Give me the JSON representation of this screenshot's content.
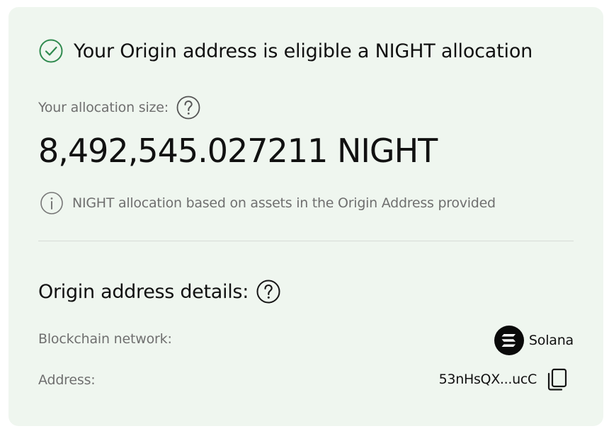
{
  "eligibility": {
    "icon": "check-circle-icon",
    "status_color": "#2f8a4e",
    "title": "Your Origin address is eligible a NIGHT allocation"
  },
  "allocation": {
    "label": "Your allocation size:",
    "help_icon": "question-circle-icon",
    "value": "8,492,545.027211 NIGHT",
    "info_icon": "info-circle-icon",
    "info_text": "NIGHT allocation based on assets in the Origin Address provided"
  },
  "details": {
    "title": "Origin address details:",
    "help_icon": "question-circle-icon",
    "network_label": "Blockchain network:",
    "network_icon": "solana-icon",
    "network_value": "Solana",
    "address_label": "Address:",
    "address_value": "53nHsQX...ucC",
    "copy_icon": "copy-icon"
  },
  "colors": {
    "card_background": "#eff6ef",
    "text_primary": "#111111",
    "text_secondary": "#6f6f6f"
  }
}
